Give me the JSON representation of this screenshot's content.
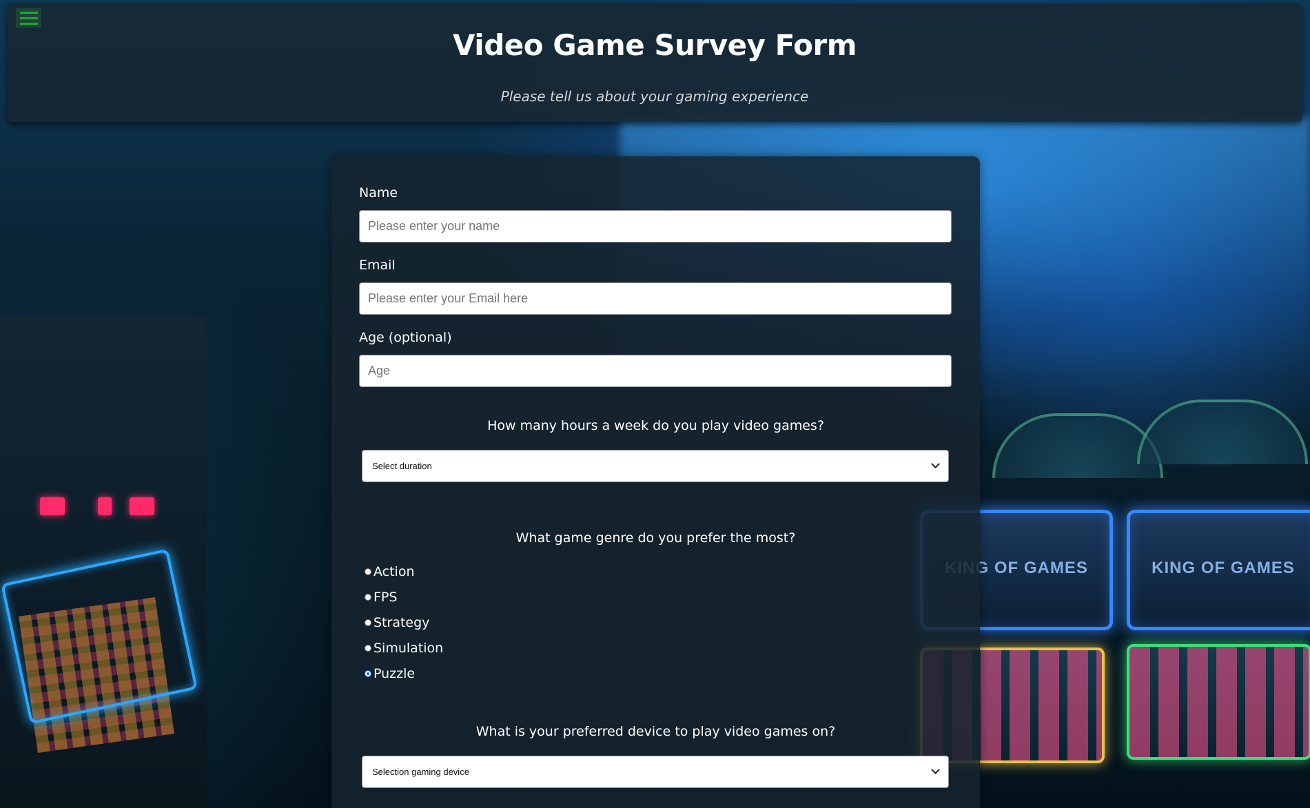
{
  "header": {
    "title": "Video Game Survey Form",
    "subtitle": "Please tell us about your gaming experience"
  },
  "form": {
    "name": {
      "label": "Name",
      "placeholder": "Please enter your name"
    },
    "email": {
      "label": "Email",
      "placeholder": "Please enter your Email here"
    },
    "age": {
      "label": "Age (optional)",
      "placeholder": "Age"
    },
    "hours": {
      "question": "How many hours a week do you play video games?",
      "selected": "Select duration"
    },
    "genre": {
      "question": "What game genre do you prefer the most?",
      "options": [
        "Action",
        "FPS",
        "Strategy",
        "Simulation",
        "Puzzle"
      ],
      "selected": "Puzzle"
    },
    "device": {
      "question": "What is your preferred device to play video games on?",
      "selected": "Selection gaming device"
    }
  },
  "background": {
    "machine_text": "KING OF GAMES",
    "accent_color": "#3a86ff",
    "led_color": "#ff2a6a"
  },
  "icons": {
    "menu": "hamburger-menu-icon",
    "dropdown": "chevron-down-icon"
  }
}
